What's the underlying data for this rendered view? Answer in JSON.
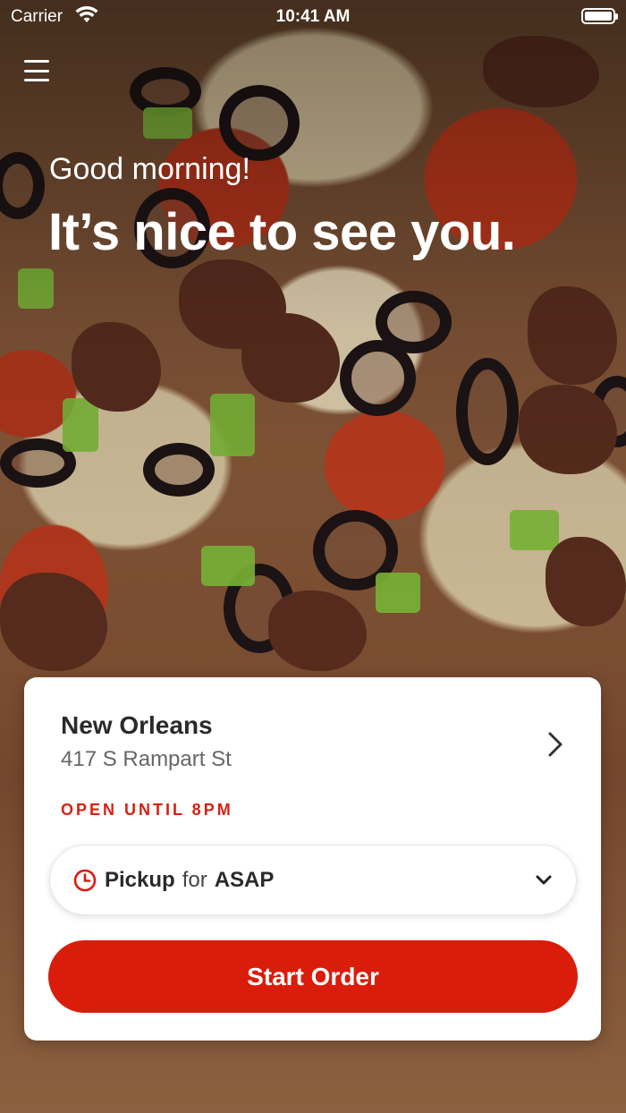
{
  "status_bar": {
    "carrier": "Carrier",
    "time": "10:41 AM",
    "icons": [
      "wifi-icon",
      "battery-icon"
    ]
  },
  "header": {
    "menu_icon": "hamburger-menu-icon",
    "greeting": "Good morning!",
    "headline": "It’s nice to see you."
  },
  "location_card": {
    "name": "New Orleans",
    "address": "417 S Rampart St",
    "status": "OPEN UNTIL 8PM",
    "chevron_icon": "chevron-right-icon"
  },
  "order_options": {
    "clock_icon": "clock-icon",
    "mode": "Pickup",
    "connector": "for",
    "time": "ASAP",
    "dropdown_icon": "chevron-down-icon"
  },
  "actions": {
    "start_order_label": "Start Order"
  },
  "colors": {
    "accent_red": "#da1c0a",
    "status_red": "#d91f0f",
    "card_bg": "#ffffff",
    "text_dark": "#2a2a2a",
    "text_muted": "#666666"
  }
}
